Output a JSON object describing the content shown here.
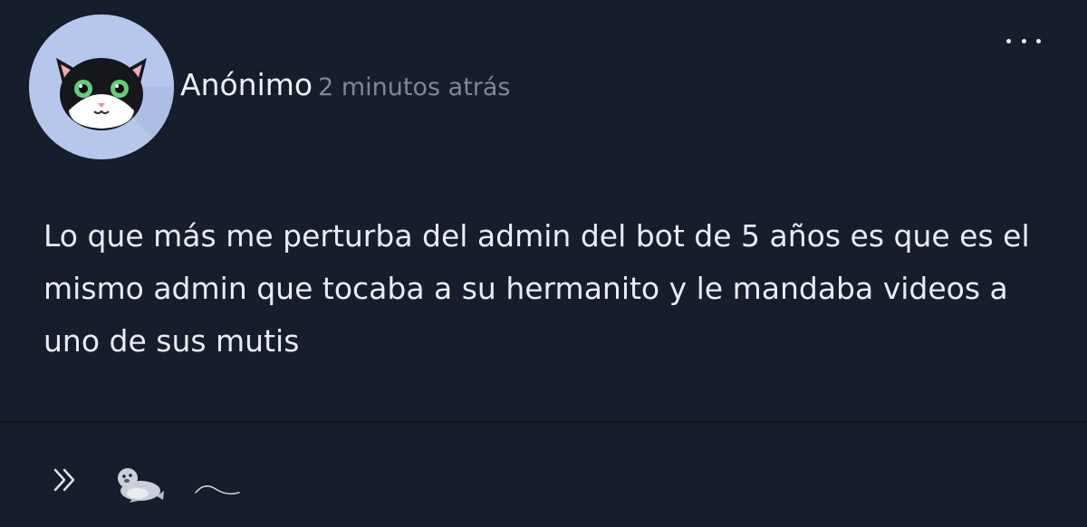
{
  "post": {
    "author": "Anónimo",
    "timestamp": "2 minutos atrás",
    "body": "Lo que más me perturba del admin del bot de 5 años es que es el mismo admin que tocaba a su hermanito y le mandaba videos a uno de sus mutis"
  },
  "icons": {
    "avatar": "black-cat-avatar",
    "more": "more-dots-icon",
    "forward": "double-chevron-right-icon",
    "emoji": "seal-emoji",
    "reaction": "tilde-wave-icon"
  },
  "colors": {
    "background": "#161e2b",
    "text": "#e9ecf1",
    "timestamp": "#7e8794",
    "avatar_bg": "#b7c7ec"
  }
}
